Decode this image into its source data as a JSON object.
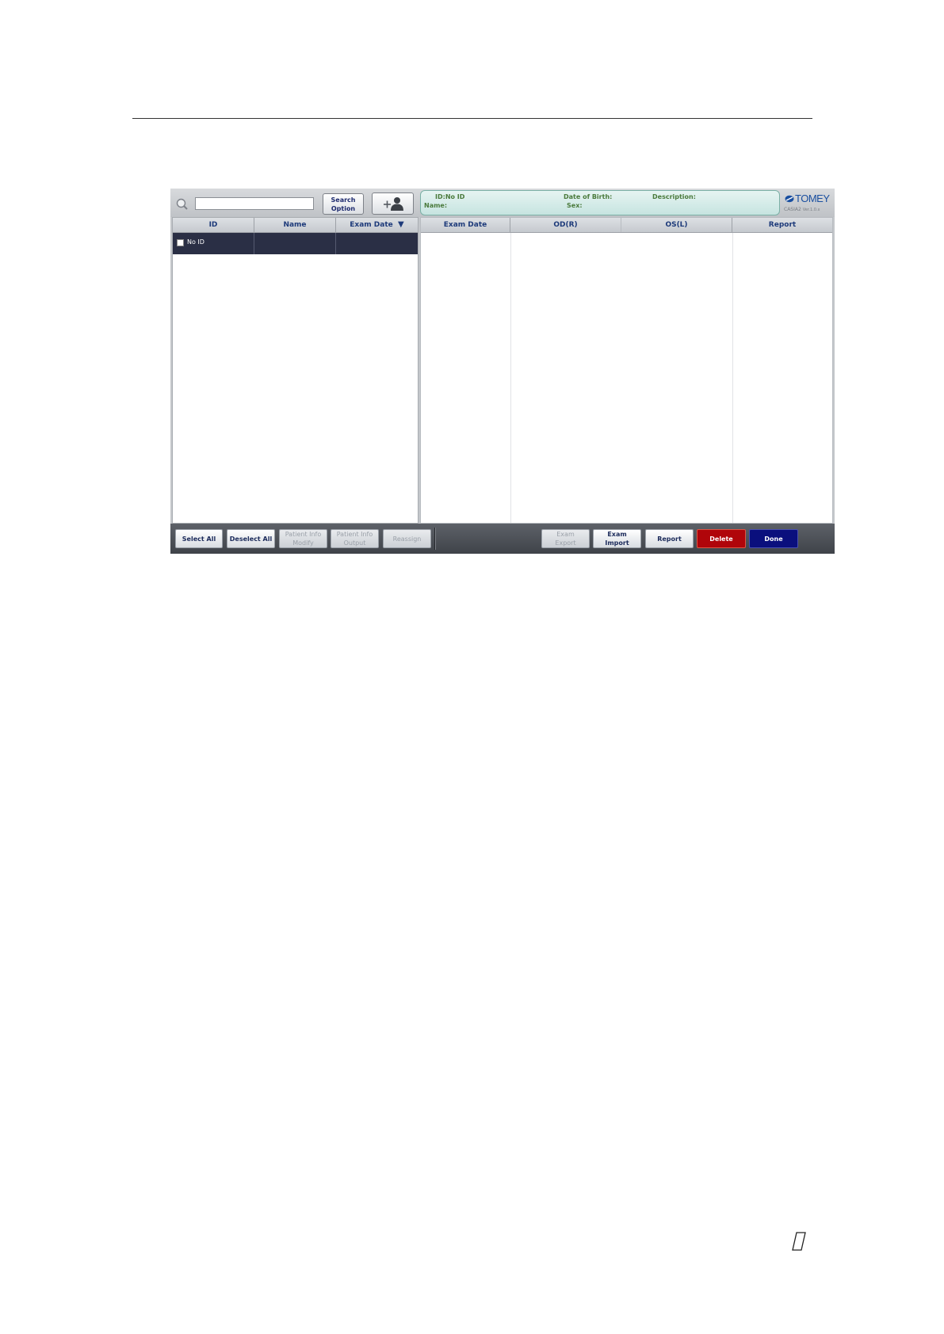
{
  "search": {
    "placeholder": "",
    "option_label_1": "Search",
    "option_label_2": "Option"
  },
  "patient_info": {
    "id_label": "ID:No ID",
    "name_label": "Name:",
    "dob_label": "Date of Birth:",
    "sex_label": "Sex:",
    "description_label": "Description:"
  },
  "logo": {
    "brand": "TOMEY",
    "product": "CASIA2",
    "version": "Ver.1.0.x"
  },
  "patient_list": {
    "columns": [
      "ID",
      "Name",
      "Exam Date"
    ],
    "sort_indicator": "▼",
    "rows": [
      {
        "id": "No ID",
        "name": "",
        "exam_date": ""
      }
    ]
  },
  "exam_list": {
    "columns": [
      "Exam Date",
      "OD(R)",
      "OS(L)",
      "Report"
    ]
  },
  "bottom_buttons": {
    "select_all": "Select All",
    "deselect_all": "Deselect All",
    "patient_info_modify_1": "Patient Info",
    "patient_info_modify_2": "Modify",
    "patient_info_output_1": "Patient Info",
    "patient_info_output_2": "Output",
    "reassign": "Reassign",
    "exam_export_1": "Exam",
    "exam_export_2": "Export",
    "exam_import_1": "Exam",
    "exam_import_2": "Import",
    "report": "Report",
    "delete": "Delete",
    "done": "Done"
  },
  "colors": {
    "accent": "#1d2a6e",
    "delete": "#b0050a",
    "done": "#0a0f7d",
    "selected_row": "#2a2f45",
    "info_panel": "#d6ece8"
  }
}
